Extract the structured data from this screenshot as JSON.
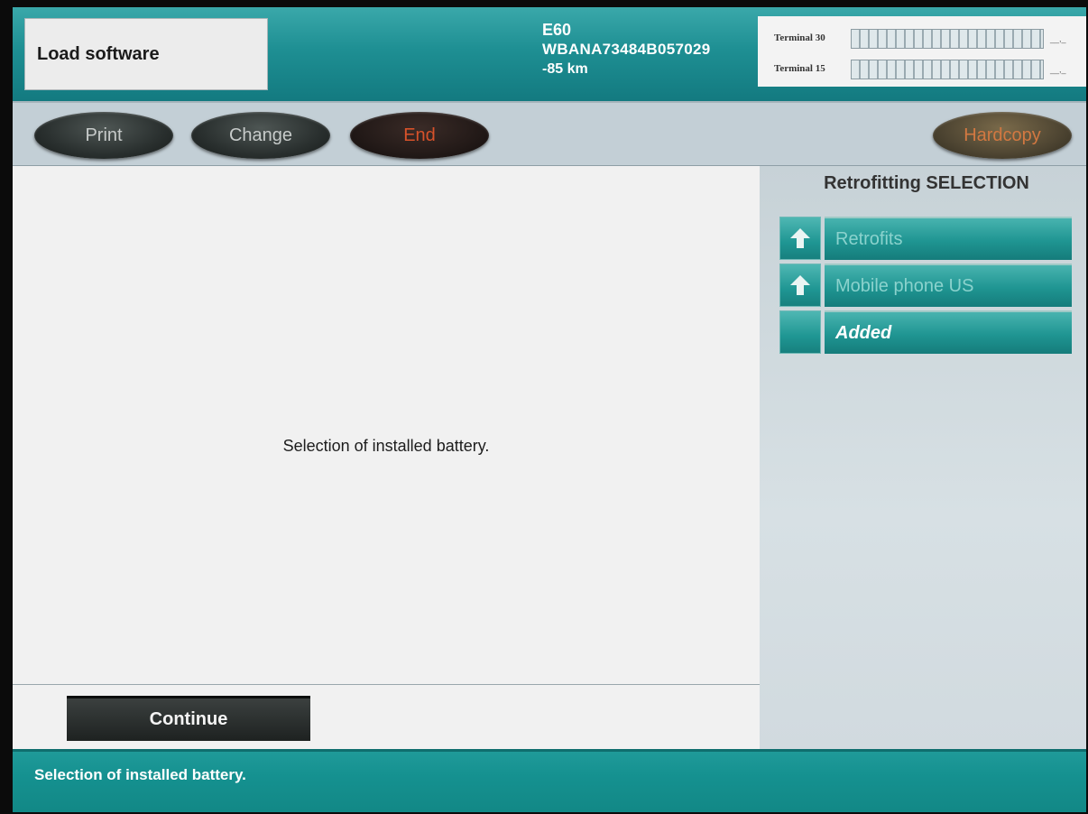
{
  "header": {
    "module_title": "Load software",
    "vehicle": {
      "series": "E60",
      "vin": "WBANA73484B057029",
      "mileage": "-85 km"
    },
    "terminals": [
      {
        "label": "Terminal 30",
        "value": "__,_"
      },
      {
        "label": "Terminal 15",
        "value": "__,_"
      }
    ]
  },
  "toolbar": {
    "print_label": "Print",
    "change_label": "Change",
    "end_label": "End",
    "hardcopy_label": "Hardcopy"
  },
  "main": {
    "message": "Selection of installed battery."
  },
  "side_panel": {
    "title": "Retrofitting SELECTION",
    "items": [
      {
        "label": "Retrofits",
        "icon": "arrow-up-icon",
        "active": false
      },
      {
        "label": "Mobile phone US",
        "icon": "arrow-up-icon",
        "active": false
      },
      {
        "label": "Added",
        "icon": "",
        "active": true
      }
    ]
  },
  "bottom": {
    "continue_label": "Continue"
  },
  "status_bar": {
    "text": "Selection of installed battery."
  },
  "colors": {
    "teal": "#1e8f93",
    "end_red": "#d7522a",
    "hardcopy_orange": "#d27841"
  }
}
